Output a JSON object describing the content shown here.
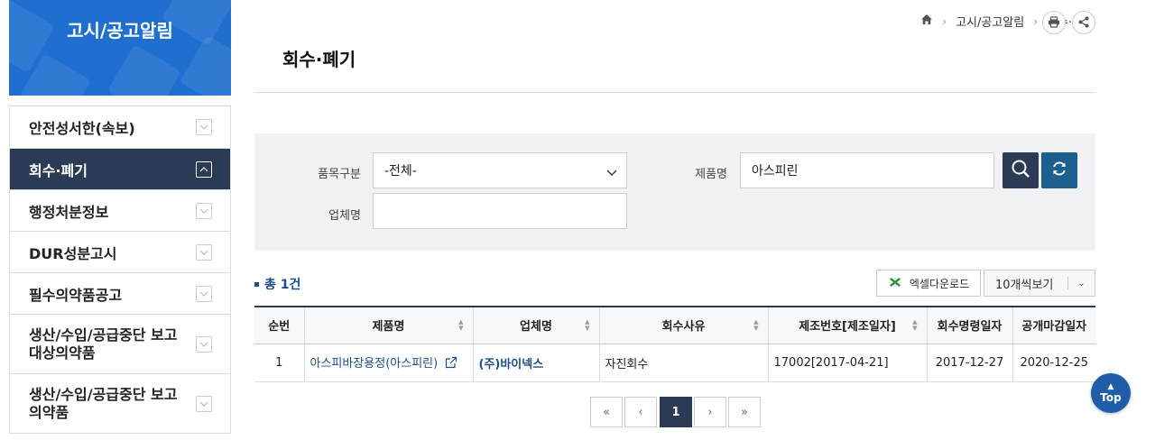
{
  "sidebar": {
    "title": "고시/공고알림",
    "items": [
      {
        "label": "안전성서한(속보)",
        "active": false
      },
      {
        "label": "회수·폐기",
        "active": true
      },
      {
        "label": "행정처분정보",
        "active": false
      },
      {
        "label": "DUR성분고시",
        "active": false
      },
      {
        "label": "필수의약품공고",
        "active": false
      },
      {
        "label": "생산/수입/공급중단 보고 대상의약품",
        "active": false
      },
      {
        "label": "생산/수입/공급중단 보고 의약품",
        "active": false
      }
    ]
  },
  "breadcrumb": {
    "items": [
      "고시/공고알림",
      "회수·폐기"
    ]
  },
  "page": {
    "title": "회수·폐기"
  },
  "search": {
    "category_label": "품목구분",
    "category_value": "-전체-",
    "product_label": "제품명",
    "product_value": "아스피린",
    "company_label": "업체명",
    "company_value": ""
  },
  "results": {
    "total": "총 1건",
    "excel_label": "엑셀다운로드",
    "per_page": "10개씩보기"
  },
  "table": {
    "headers": [
      "순번",
      "제품명",
      "업체명",
      "회수사유",
      "제조번호[제조일자]",
      "회수명령일자",
      "공개마감일자"
    ],
    "rows": [
      {
        "no": "1",
        "product": "아스피바장용정(아스피린)",
        "company": "(주)바이넥스",
        "reason": "자진회수",
        "lot": "17002[2017-04-21]",
        "order_date": "2017-12-27",
        "close_date": "2020-12-25"
      }
    ]
  },
  "pagination": {
    "current": "1"
  },
  "top_label": "Top",
  "colors": {
    "accent": "#2b3a55",
    "brand": "#1f6fd0",
    "link": "#1a4f8b"
  }
}
